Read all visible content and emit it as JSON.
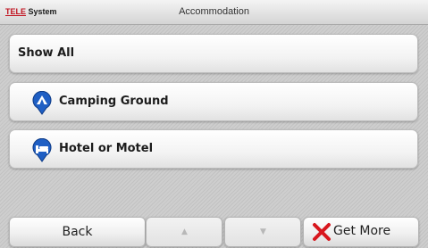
{
  "header": {
    "logo_tele": "TELE",
    "logo_system": " System",
    "title": "Accommodation"
  },
  "list": {
    "items": [
      {
        "label": "Show All",
        "icon": null
      },
      {
        "label": "Camping Ground",
        "icon": "camping-pin-icon"
      },
      {
        "label": "Hotel or Motel",
        "icon": "hotel-pin-icon"
      }
    ]
  },
  "toolbar": {
    "back_label": "Back",
    "up_label": "▲",
    "down_label": "▼",
    "getmore_label": "Get More",
    "getmore_icon": "red-x-icon"
  },
  "colors": {
    "pin_blue": "#1f5fc4",
    "x_red": "#d8171e",
    "logo_red": "#c1121f"
  }
}
